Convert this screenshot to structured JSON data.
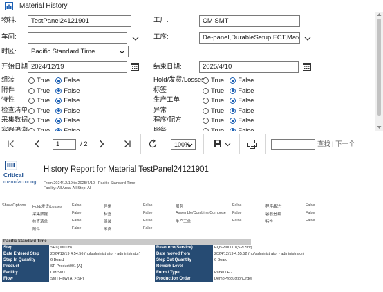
{
  "window": {
    "title": "Material History"
  },
  "filters": {
    "material_label": "物料:",
    "material_value": "TestPanel24121901",
    "factory_label": "工厂:",
    "factory_value": "CM SMT",
    "workshop_label": "车间:",
    "workshop_value": "",
    "step_label": "工序:",
    "step_value": "De-panel,DurableSetup,FCT,Materiall",
    "timezone_label": "时区:",
    "timezone_value": "Pacific Standard Time",
    "start_label": "开始日期:",
    "start_value": "2024/12/19",
    "end_label": "结束日期:",
    "end_value": "2025/4/10",
    "true_label": "True",
    "false_label": "False",
    "left_options": [
      {
        "label": "组装",
        "value": "False"
      },
      {
        "label": "附件",
        "value": "False"
      },
      {
        "label": "特性",
        "value": "False"
      },
      {
        "label": "检查清单",
        "value": "False"
      },
      {
        "label": "采集数据",
        "value": "False"
      },
      {
        "label": "容器追溯",
        "value": "False"
      }
    ],
    "right_options": [
      {
        "label": "Hold/发货/Losses",
        "value": "False"
      },
      {
        "label": "标签",
        "value": "False"
      },
      {
        "label": "生产工单",
        "value": "False"
      },
      {
        "label": "异常",
        "value": "False"
      },
      {
        "label": "程序/配方",
        "value": "False"
      },
      {
        "label": "服务",
        "value": "False"
      }
    ]
  },
  "toolbar": {
    "page_value": "1",
    "page_total": "/ 2",
    "zoom_value": "100%",
    "find_label": "查找",
    "next_label": "| 下一个"
  },
  "report": {
    "logo_line1": "Critical",
    "logo_line2": "manufacturing",
    "title": "History Report for Material TestPanel24121901",
    "range_line": "From 2024/12/19 to 2025/4/10 - Pacific Standard Time",
    "filter_line": "Facility: All  Area: All  Step: All",
    "show_options_label": "Show Options",
    "show_options": [
      [
        "Hold/发货/Losses",
        "False",
        "异常",
        "False",
        "服务",
        "False",
        "程序/配方",
        "False"
      ],
      [
        "采集数据",
        "False",
        "标签",
        "False",
        "Assemble/Combine/Compose",
        "False",
        "容器追溯",
        "False"
      ],
      [
        "检查清单",
        "False",
        "组装",
        "False",
        "生产工单",
        "False",
        "特性",
        "False"
      ],
      [
        "附件",
        "False",
        "不良",
        "False",
        "",
        "",
        "",
        ""
      ]
    ],
    "section_title": "Pacific Standard Time",
    "details": [
      {
        "k1": "Step",
        "v1": "SPI (0h01m)",
        "k2": "Resource(Service)",
        "v2": "EQSPI00001(SPI Srv)"
      },
      {
        "k1": "Date Entered Step",
        "v1": "2024/12/19 4:54:56 (ngl\\administrator - administrator)",
        "k2": "Date moved from",
        "v2": "2024/12/19 4:55:52 (ngl\\administrator - administrator)"
      },
      {
        "k1": "Step In Quantity",
        "v1": "6 Board",
        "k2": "Step Out Quantity",
        "v2": "6 Board"
      },
      {
        "k1": "Product",
        "v1": "SF-Product001 [A]",
        "k2": "Rework Level",
        "v2": ""
      },
      {
        "k1": "Facility",
        "v1": "CM SMT",
        "k2": "Form / Type",
        "v2": "Panel / FG"
      },
      {
        "k1": "Flow",
        "v1": "SMT Flow [A] > SPI",
        "k2": "Production Order",
        "v2": "DemoProductionOrder"
      }
    ]
  }
}
